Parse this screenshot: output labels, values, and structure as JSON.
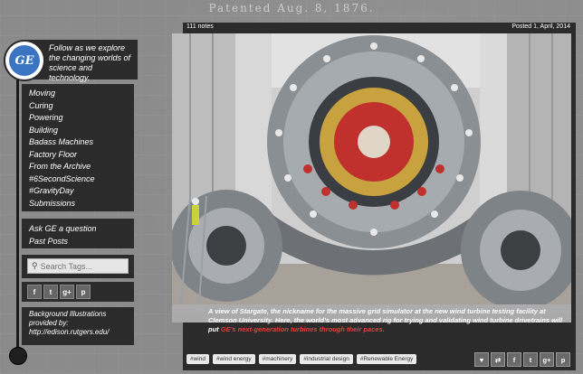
{
  "header": {
    "patent_text": "Patented Aug. 8, 1876."
  },
  "brand": {
    "logo_text": "GE"
  },
  "intro": {
    "text": "Follow as we explore the changing worlds of science and technology."
  },
  "nav": {
    "items": [
      "Moving",
      "Curing",
      "Powering",
      "Building",
      "Badass Machines",
      "Factory Floor",
      "From the Archive",
      "#6SecondScience",
      "#GravityDay",
      "Submissions"
    ]
  },
  "nav2": {
    "items": [
      "Ask GE a question",
      "Past Posts"
    ]
  },
  "search": {
    "placeholder": "Search Tags..."
  },
  "social_left": {
    "icons": [
      "facebook-icon",
      "twitter-icon",
      "google-plus-icon",
      "pinterest-icon"
    ],
    "labels": [
      "f",
      "t",
      "g+",
      "p"
    ]
  },
  "credit": {
    "text": "Background Illustrations provided by: http://edison.rutgers.edu/"
  },
  "post": {
    "notes": "111 notes",
    "posted": "Posted 1, April, 2014",
    "caption_main": "A view of Stargate, the nickname for the massive grid simulator at the new wind turbine testing facility at Clemson University. Here, the world's most advanced rig for trying and validating wind turbine drivetrains will put ",
    "caption_link": "GE's next-generation turbines through their paces.",
    "tags": [
      "#wind",
      "#wind energy",
      "#machinery",
      "#industrial design",
      "#Renewable Energy"
    ],
    "actions": [
      "heart-icon",
      "reblog-icon",
      "facebook-icon",
      "twitter-icon",
      "google-plus-icon",
      "pinterest-icon"
    ],
    "action_labels": [
      "♥",
      "⇄",
      "f",
      "t",
      "g+",
      "p"
    ]
  },
  "colors": {
    "panel": "#2b2b2b",
    "link": "#e0403c",
    "logo_blue": "#3b74c0"
  }
}
